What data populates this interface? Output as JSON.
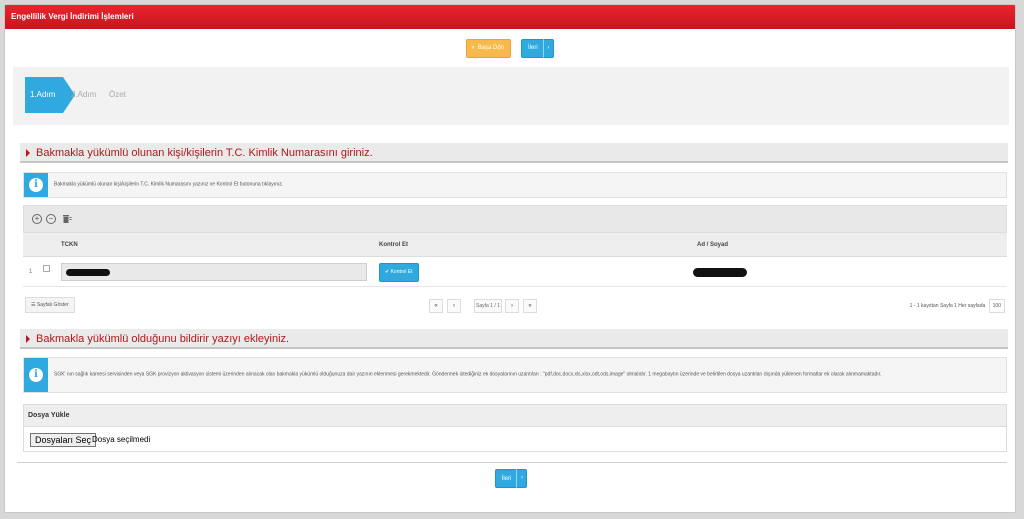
{
  "window": {
    "title": "Engellilik Vergi İndirimi İşlemleri"
  },
  "nav": {
    "back_label": "Başa Dön",
    "next_label": "İleri"
  },
  "wizard": {
    "steps": [
      "1.Adım",
      "2.Adım",
      "Özet"
    ]
  },
  "section1": {
    "title": "Bakmakla yükümlü olunan kişi/kişilerin T.C. Kimlik Numarasını giriniz.",
    "info": "Bakmakla yükümlü olunan kişi/kişilerin T.C. Kimlik Numarasını yazınız ve Kontrol Et butonuna tıklayınız."
  },
  "grid": {
    "columns": [
      "TCKN",
      "Kontrol Et",
      "Ad / Soyad"
    ],
    "rows": [
      {
        "num": "1",
        "button": "Kontrol Et"
      }
    ],
    "show_page_label": "Sayfalı Göster",
    "pager_text": "Sayfa 1 / 1",
    "records_text": "1 - 1 kayıttan   Sayfa 1  Her sayfada",
    "page_size": "100"
  },
  "section2": {
    "title": "Bakmakla yükümlü olduğunu bildirir yazıyı ekleyiniz.",
    "info": "SGK' nın sağlık karnesi servisinden veya SGK provizyon aktivasyon sistemi üzerinden alınacak olan bakmakla yükümlü olduğunuza dair yazının eklenmesi gerekmektedir. Göndermek istediğiniz ek dosyalarının uzantıları : \"pdf,doc,docx,xls,xlsx,odt,ods,image\" olmalıdır. 1 megabaytın üzerinde ve belirtilen dosya uzantıları dışında yüklenen formatlar ek olarak alınmamaktadır."
  },
  "upload": {
    "header": "Dosya Yükle",
    "button": "Dosyaları Seç",
    "status": "Dosya seçilmedi"
  },
  "colors": {
    "title_red": "#d01a22",
    "accent_blue": "#30a9de",
    "back_yellow": "#f7b94a",
    "section_red": "#b01818"
  }
}
